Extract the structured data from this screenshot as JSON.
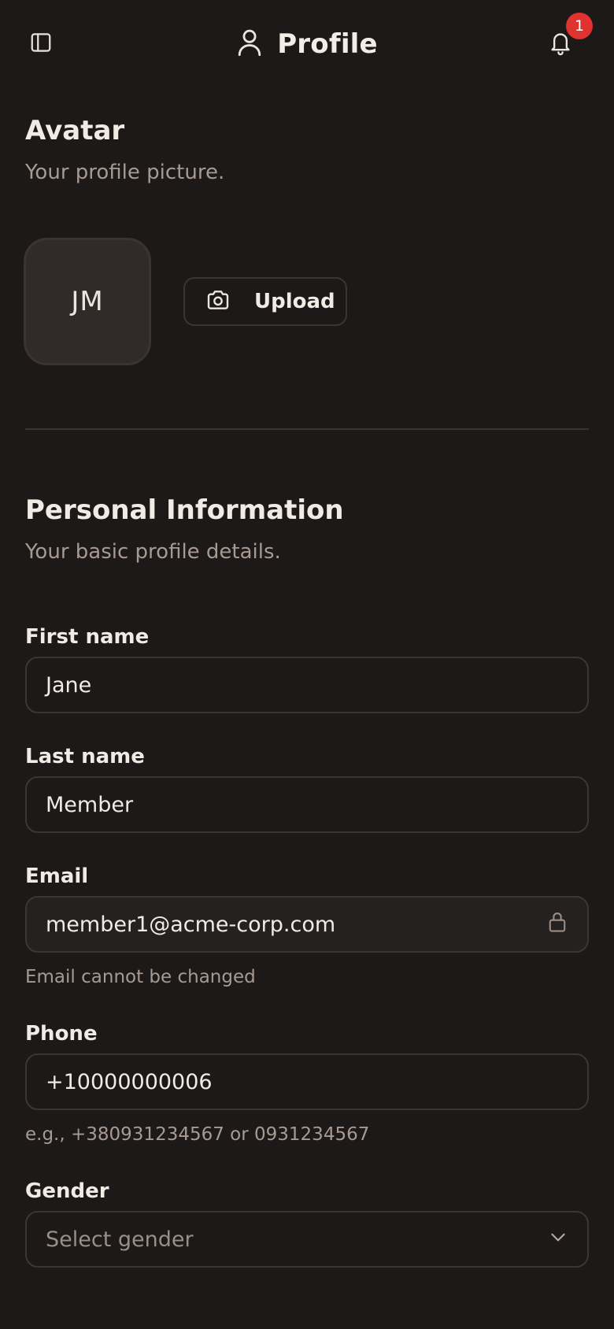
{
  "header": {
    "title": "Profile",
    "notification_count": "1",
    "icons": {
      "sidebar": "sidebar-toggle-icon",
      "user": "user-icon",
      "bell": "bell-icon"
    }
  },
  "avatar_section": {
    "title": "Avatar",
    "subtitle": "Your profile picture.",
    "initials": "JM",
    "upload_label": "Upload",
    "upload_icon": "camera-icon"
  },
  "personal_section": {
    "title": "Personal Information",
    "subtitle": "Your basic profile details.",
    "fields": {
      "first_name": {
        "label": "First name",
        "value": "Jane"
      },
      "last_name": {
        "label": "Last name",
        "value": "Member"
      },
      "email": {
        "label": "Email",
        "value": "member1@acme-corp.com",
        "helper": "Email cannot be changed",
        "icon": "lock-icon"
      },
      "phone": {
        "label": "Phone",
        "value": "+10000000006",
        "helper": "e.g., +380931234567 or 0931234567"
      },
      "gender": {
        "label": "Gender",
        "placeholder": "Select gender",
        "icon": "chevron-down-icon"
      }
    }
  },
  "colors": {
    "background": "#1d1918",
    "text": "#f1ebe6",
    "muted": "#a79a93",
    "border": "#3c3633",
    "badge": "#e0322f"
  }
}
